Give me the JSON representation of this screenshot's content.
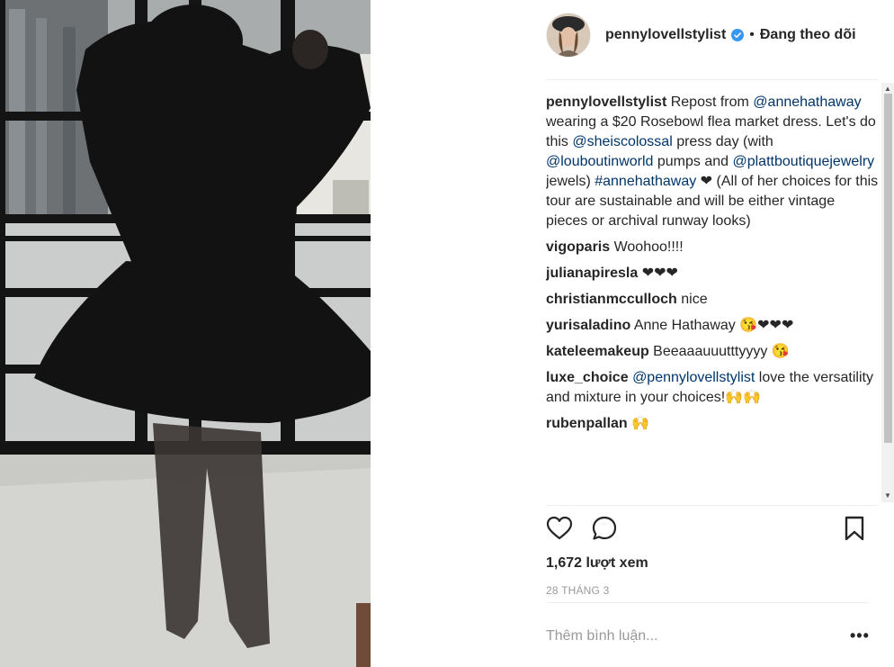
{
  "post": {
    "username": "pennylovellstylist",
    "separator": "•",
    "follow_status": "Đang theo dõi",
    "caption": {
      "author": "pennylovellstylist",
      "t1": " Repost from ",
      "m1": "@annehathaway",
      "t2": " wearing a $20 Rosebowl flea market dress. Let's do this ",
      "m2": "@sheiscolossal",
      "t3": " press day (with ",
      "m3": "@louboutinworld",
      "t4": " pumps and ",
      "m4": "@plattboutiquejewelry",
      "t5": " jewels) ",
      "m5": "#annehathaway",
      "t6": " ❤ (All of her choices for this tour are sustainable and will be either vintage pieces or archival runway looks)"
    },
    "comments": [
      {
        "user": "vigoparis",
        "text": " Woohoo!!!!"
      },
      {
        "user": "julianapiresla",
        "text": " ❤❤❤"
      },
      {
        "user": "christianmcculloch",
        "text": " nice"
      },
      {
        "user": "yurisaladino",
        "text": " Anne Hathaway 😘❤❤❤"
      },
      {
        "user": "kateleemakeup",
        "text": " Beeaaauuutttyyyy 😘"
      },
      {
        "user": "luxe_choice",
        "mention": "@pennylovellstylist",
        "text": " love the versatility and mixture in your choices!🙌🙌"
      },
      {
        "user": "rubenpallan",
        "text": " 🙌"
      }
    ],
    "views": "1,672 lượt xem",
    "date": "28 THÁNG 3",
    "add_comment_placeholder": "Thêm bình luận...",
    "more_label": "•••"
  }
}
